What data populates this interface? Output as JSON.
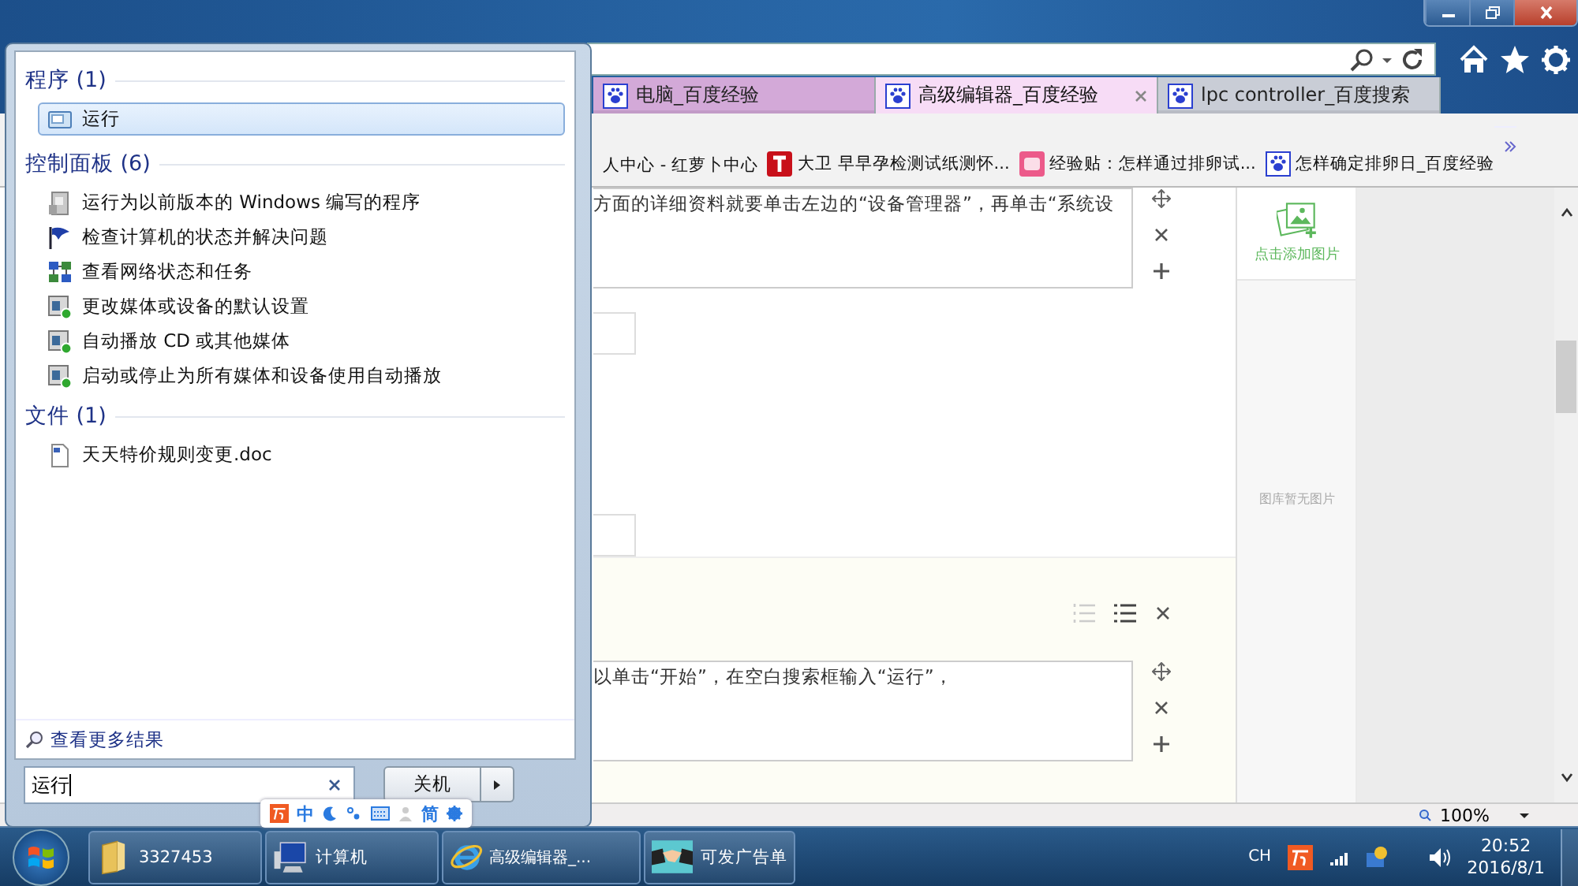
{
  "browser": {
    "tabs": [
      {
        "label": "电脑_百度经验",
        "selected": false,
        "color": "#d3a9d8"
      },
      {
        "label": "高级编辑器_百度经验",
        "selected": true,
        "color": "#f7dcf6"
      },
      {
        "label": "lpc controller_百度搜索",
        "selected": false,
        "color": "#c9cdd6"
      }
    ],
    "favorites": [
      {
        "label": "人中心 - 红萝卜中心",
        "kind": "none"
      },
      {
        "label": "大卫 早早孕检测试纸测怀...",
        "kind": "t"
      },
      {
        "label": "经验贴：怎样通过排卵试...",
        "kind": "bo"
      },
      {
        "label": "怎样确定排卵日_百度经验",
        "kind": "paw"
      }
    ],
    "editor": {
      "blocks": [
        {
          "text": "方面的详细资料就要单击左边的“设备管理器”，再单击“系统设"
        },
        {
          "text": "以单击“开始”，在空白搜索框输入“运行”，"
        }
      ]
    },
    "side_panel": {
      "add_label": "点击添加图片",
      "empty_label": "图库暂无图片"
    },
    "status_bar": {
      "zoom": "100%"
    }
  },
  "start_menu": {
    "groups": [
      {
        "title": "程序 (1)",
        "items": [
          {
            "label": "运行",
            "kind": "run",
            "selected": true
          }
        ]
      },
      {
        "title": "控制面板 (6)",
        "items": [
          {
            "label": "运行为以前版本的 Windows 编写的程序",
            "kind": "compat",
            "selected": false
          },
          {
            "label": "检查计算机的状态并解决问题",
            "kind": "flag",
            "selected": false
          },
          {
            "label": "查看网络状态和任务",
            "kind": "network",
            "selected": false
          },
          {
            "label": "更改媒体或设备的默认设置",
            "kind": "media",
            "selected": false
          },
          {
            "label": "自动播放 CD 或其他媒体",
            "kind": "media",
            "selected": false
          },
          {
            "label": "启动或停止为所有媒体和设备使用自动播放",
            "kind": "media",
            "selected": false
          }
        ]
      },
      {
        "title": "文件 (1)",
        "items": [
          {
            "label": "天天特价规则变更.doc",
            "kind": "doc",
            "selected": false
          }
        ]
      }
    ],
    "more_results": "查看更多结果",
    "search": {
      "value": "运行"
    },
    "shutdown": "关机"
  },
  "ime_bar": {
    "mode": "中",
    "script": "简"
  },
  "taskbar": {
    "buttons": [
      {
        "label": "3327453",
        "kind": "folder"
      },
      {
        "label": "计算机",
        "kind": "computer"
      },
      {
        "label": "高级编辑器_...",
        "kind": "browser"
      },
      {
        "label": "可发广告单",
        "kind": "handshake"
      }
    ],
    "tray": {
      "language": "CH",
      "time": "20:52",
      "date": "2016/8/1"
    }
  }
}
